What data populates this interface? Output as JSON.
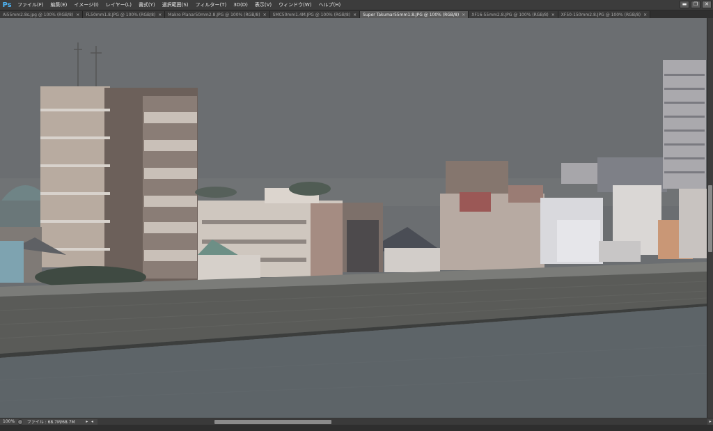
{
  "app": {
    "logo": "Ps"
  },
  "menu": {
    "items": [
      "ファイル(F)",
      "編集(E)",
      "イメージ(I)",
      "レイヤー(L)",
      "書式(Y)",
      "選択範囲(S)",
      "フィルター(T)",
      "3D(D)",
      "表示(V)",
      "ウィンドウ(W)",
      "ヘルプ(H)"
    ]
  },
  "window_controls": {
    "minimize": "▬",
    "restore": "❐",
    "close": "✕"
  },
  "tabs": [
    {
      "label": "Ai55mm2.8s.jpg @ 100% (RGB/8)",
      "active": false
    },
    {
      "label": "FL50mm1.8.JPG @ 100% (RGB/8)",
      "active": false
    },
    {
      "label": "Makro Planar50mm2.8.JPG @ 100% (RGB/8)",
      "active": false
    },
    {
      "label": "SMC50mm1.4M.JPG @ 100% (RGB/8)",
      "active": false
    },
    {
      "label": "Super Takumar55mm1.8.JPG @ 100% (RGB/8)",
      "active": true
    },
    {
      "label": "XF16-55mm2.8.JPG @ 100% (RGB/8)",
      "active": false
    },
    {
      "label": "XF50-150mm2.8.JPG @ 100% (RGB/8)",
      "active": false
    }
  ],
  "tab_close_glyph": "×",
  "status": {
    "zoom": "100%",
    "file_info": "ファイル : 68.7M/68.7M",
    "arrow_left": "◂",
    "arrow_right": "▸"
  },
  "colors": {
    "sky": "#6b6e71",
    "water": "#5d6468",
    "wall": "#5a5b58",
    "accent": "#4fb3f2"
  }
}
